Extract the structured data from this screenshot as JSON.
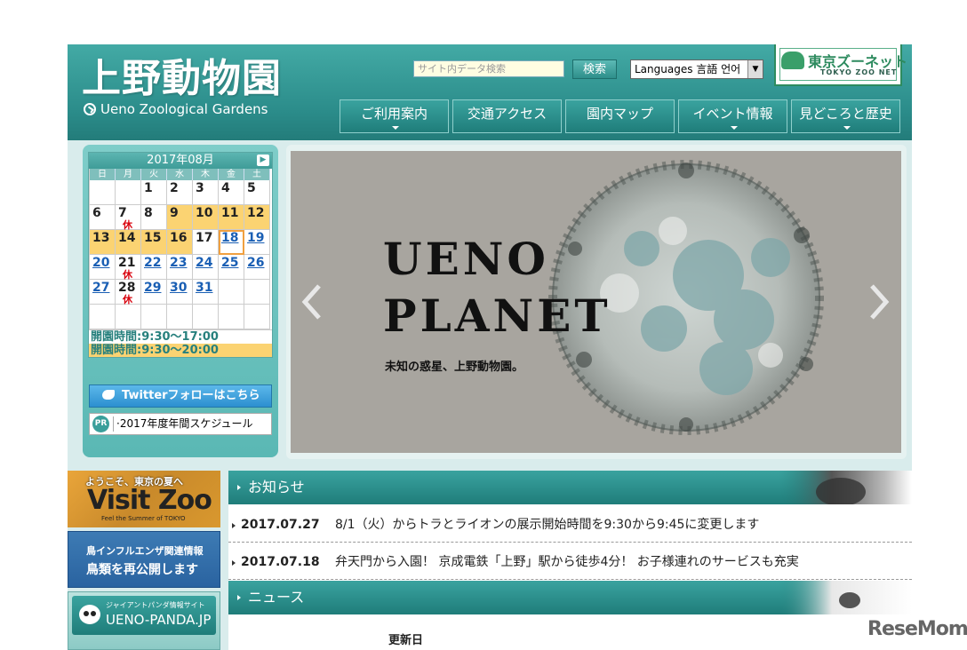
{
  "header": {
    "logo_title": "上野動物園",
    "logo_subtitle": "Ueno Zoological Gardens",
    "search_placeholder": "サイト内データ検索",
    "search_button": "検索",
    "language_select": "Languages 言語 언어",
    "zoo_net_name": "東京ズーネット",
    "zoo_net_en": "TOKYO ZOO NET"
  },
  "nav": [
    {
      "label": "ご利用案内"
    },
    {
      "label": "交通アクセス"
    },
    {
      "label": "園内マップ"
    },
    {
      "label": "イベント情報"
    },
    {
      "label": "見どころと歴史"
    }
  ],
  "calendar": {
    "month_label": "2017年08月",
    "next_icon": "chevron-right-icon",
    "weekdays": [
      "日",
      "月",
      "火",
      "水",
      "木",
      "金",
      "土"
    ],
    "days": [
      {
        "n": "",
        "closed": false,
        "long_hours": false,
        "link": false
      },
      {
        "n": "",
        "closed": false,
        "long_hours": false,
        "link": false
      },
      {
        "n": "1",
        "closed": false,
        "long_hours": false,
        "link": false
      },
      {
        "n": "2",
        "closed": false,
        "long_hours": false,
        "link": false
      },
      {
        "n": "3",
        "closed": false,
        "long_hours": false,
        "link": false
      },
      {
        "n": "4",
        "closed": false,
        "long_hours": false,
        "link": false
      },
      {
        "n": "5",
        "closed": false,
        "long_hours": false,
        "link": false
      },
      {
        "n": "6",
        "closed": false,
        "long_hours": false,
        "link": false
      },
      {
        "n": "7",
        "closed": true,
        "long_hours": false,
        "link": false
      },
      {
        "n": "8",
        "closed": false,
        "long_hours": false,
        "link": false
      },
      {
        "n": "9",
        "closed": false,
        "long_hours": true,
        "link": false
      },
      {
        "n": "10",
        "closed": false,
        "long_hours": true,
        "link": false
      },
      {
        "n": "11",
        "closed": false,
        "long_hours": true,
        "link": false
      },
      {
        "n": "12",
        "closed": false,
        "long_hours": true,
        "link": false
      },
      {
        "n": "13",
        "closed": false,
        "long_hours": true,
        "link": false
      },
      {
        "n": "14",
        "closed": false,
        "long_hours": true,
        "link": false
      },
      {
        "n": "15",
        "closed": false,
        "long_hours": true,
        "link": false
      },
      {
        "n": "16",
        "closed": false,
        "long_hours": true,
        "link": false
      },
      {
        "n": "17",
        "closed": false,
        "long_hours": false,
        "link": false
      },
      {
        "n": "18",
        "closed": false,
        "long_hours": false,
        "link": true,
        "today": true
      },
      {
        "n": "19",
        "closed": false,
        "long_hours": false,
        "link": true
      },
      {
        "n": "20",
        "closed": false,
        "long_hours": false,
        "link": true
      },
      {
        "n": "21",
        "closed": true,
        "long_hours": false,
        "link": false
      },
      {
        "n": "22",
        "closed": false,
        "long_hours": false,
        "link": true
      },
      {
        "n": "23",
        "closed": false,
        "long_hours": false,
        "link": true
      },
      {
        "n": "24",
        "closed": false,
        "long_hours": false,
        "link": true
      },
      {
        "n": "25",
        "closed": false,
        "long_hours": false,
        "link": true
      },
      {
        "n": "26",
        "closed": false,
        "long_hours": false,
        "link": true
      },
      {
        "n": "27",
        "closed": false,
        "long_hours": false,
        "link": true
      },
      {
        "n": "28",
        "closed": true,
        "long_hours": false,
        "link": false
      },
      {
        "n": "29",
        "closed": false,
        "long_hours": false,
        "link": true
      },
      {
        "n": "30",
        "closed": false,
        "long_hours": false,
        "link": true
      },
      {
        "n": "31",
        "closed": false,
        "long_hours": false,
        "link": true
      },
      {
        "n": "",
        "closed": false,
        "long_hours": false,
        "link": false
      },
      {
        "n": "",
        "closed": false,
        "long_hours": false,
        "link": false
      },
      {
        "n": "",
        "closed": false,
        "long_hours": false,
        "link": false
      },
      {
        "n": "",
        "closed": false,
        "long_hours": false,
        "link": false
      },
      {
        "n": "",
        "closed": false,
        "long_hours": false,
        "link": false
      },
      {
        "n": "",
        "closed": false,
        "long_hours": false,
        "link": false
      },
      {
        "n": "",
        "closed": false,
        "long_hours": false,
        "link": false
      },
      {
        "n": "",
        "closed": false,
        "long_hours": false,
        "link": false
      },
      {
        "n": "",
        "closed": false,
        "long_hours": false,
        "link": false
      }
    ],
    "closed_label": "休",
    "hours_normal": "開園時間:9:30～17:00",
    "hours_extended": "開園時間:9:30～20:00",
    "colors": {
      "extended": "#fbd372",
      "closed": "#d8000c",
      "link": "#1a5fb4"
    }
  },
  "twitter_button": "Twitterフォローはこちら",
  "pr": {
    "badge": "PR",
    "text": "·2017年度年間スケジュール"
  },
  "slider": {
    "title_line1": "UENO",
    "title_line2": "PLANET",
    "tagline": "未知の惑星、上野動物園。",
    "prev_icon": "chevron-left-icon",
    "next_icon": "chevron-right-icon"
  },
  "banners": {
    "visit_zoo_top": "ようこそ、東京の夏へ",
    "visit_zoo_main": "Visit Zoo",
    "visit_zoo_sub": "Feel the Summer of TOKYO",
    "bird_flu_line1": "鳥インフルエンザ関連情報",
    "bird_flu_line2": "鳥類を再公開します",
    "panda_line1": "ジャイアントパンダ情報サイト",
    "panda_line2": "UENO-PANDA.JP"
  },
  "notices": {
    "header": "お知らせ",
    "items": [
      {
        "date": "2017.07.27",
        "text": "8/1（火）からトラとライオンの展示開始時間を9:30から9:45に変更します"
      },
      {
        "date": "2017.07.18",
        "text": "弁天門から入園！ 京成電鉄「上野」駅から徒歩4分！ お子様連れのサービスも充実"
      }
    ]
  },
  "news": {
    "header": "ニュース",
    "update_label": "更新日"
  },
  "watermark": "ReseMom"
}
